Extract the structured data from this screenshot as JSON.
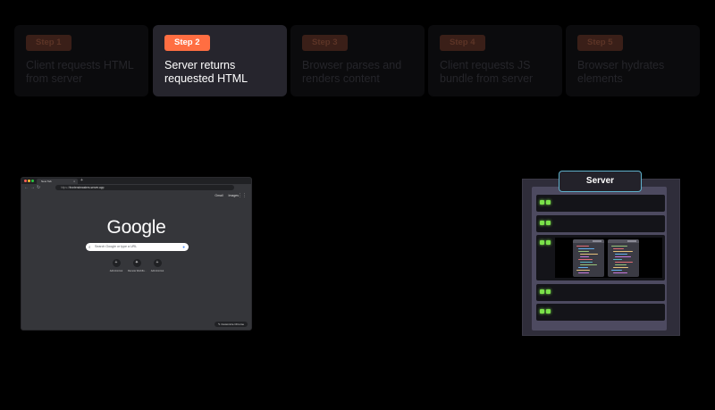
{
  "steps": [
    {
      "badge": "Step 1",
      "text": "Client requests HTML from server",
      "active": false
    },
    {
      "badge": "Step 2",
      "text": "Server returns requested HTML",
      "active": true
    },
    {
      "badge": "Step 3",
      "text": "Browser parses and renders content",
      "active": false
    },
    {
      "badge": "Step 4",
      "text": "Client requests JS bundle from server",
      "active": false
    },
    {
      "badge": "Step 5",
      "text": "Browser hydrates elements",
      "active": false
    }
  ],
  "browser": {
    "tab_title": "New Tab",
    "url_prefix": "https://",
    "url": "frontendmasters.server.app",
    "toplinks": [
      "Gmail",
      "Images"
    ],
    "logo": "Google",
    "search_placeholder": "Search Google or type a URL",
    "shortcuts": [
      "Add shortcut",
      "Remote Workflo...",
      "Add shortcut"
    ],
    "customize": "Customize Chrome"
  },
  "server": {
    "label": "Server"
  },
  "colors": {
    "accent": "#ff6e42",
    "active_step_bg": "#26252d",
    "led": "#7be24a",
    "server_border": "#5fb1cc"
  },
  "icons": [
    "search-icon",
    "mic-icon",
    "apps-icon",
    "back-icon",
    "forward-icon",
    "reload-icon",
    "plus-icon"
  ]
}
